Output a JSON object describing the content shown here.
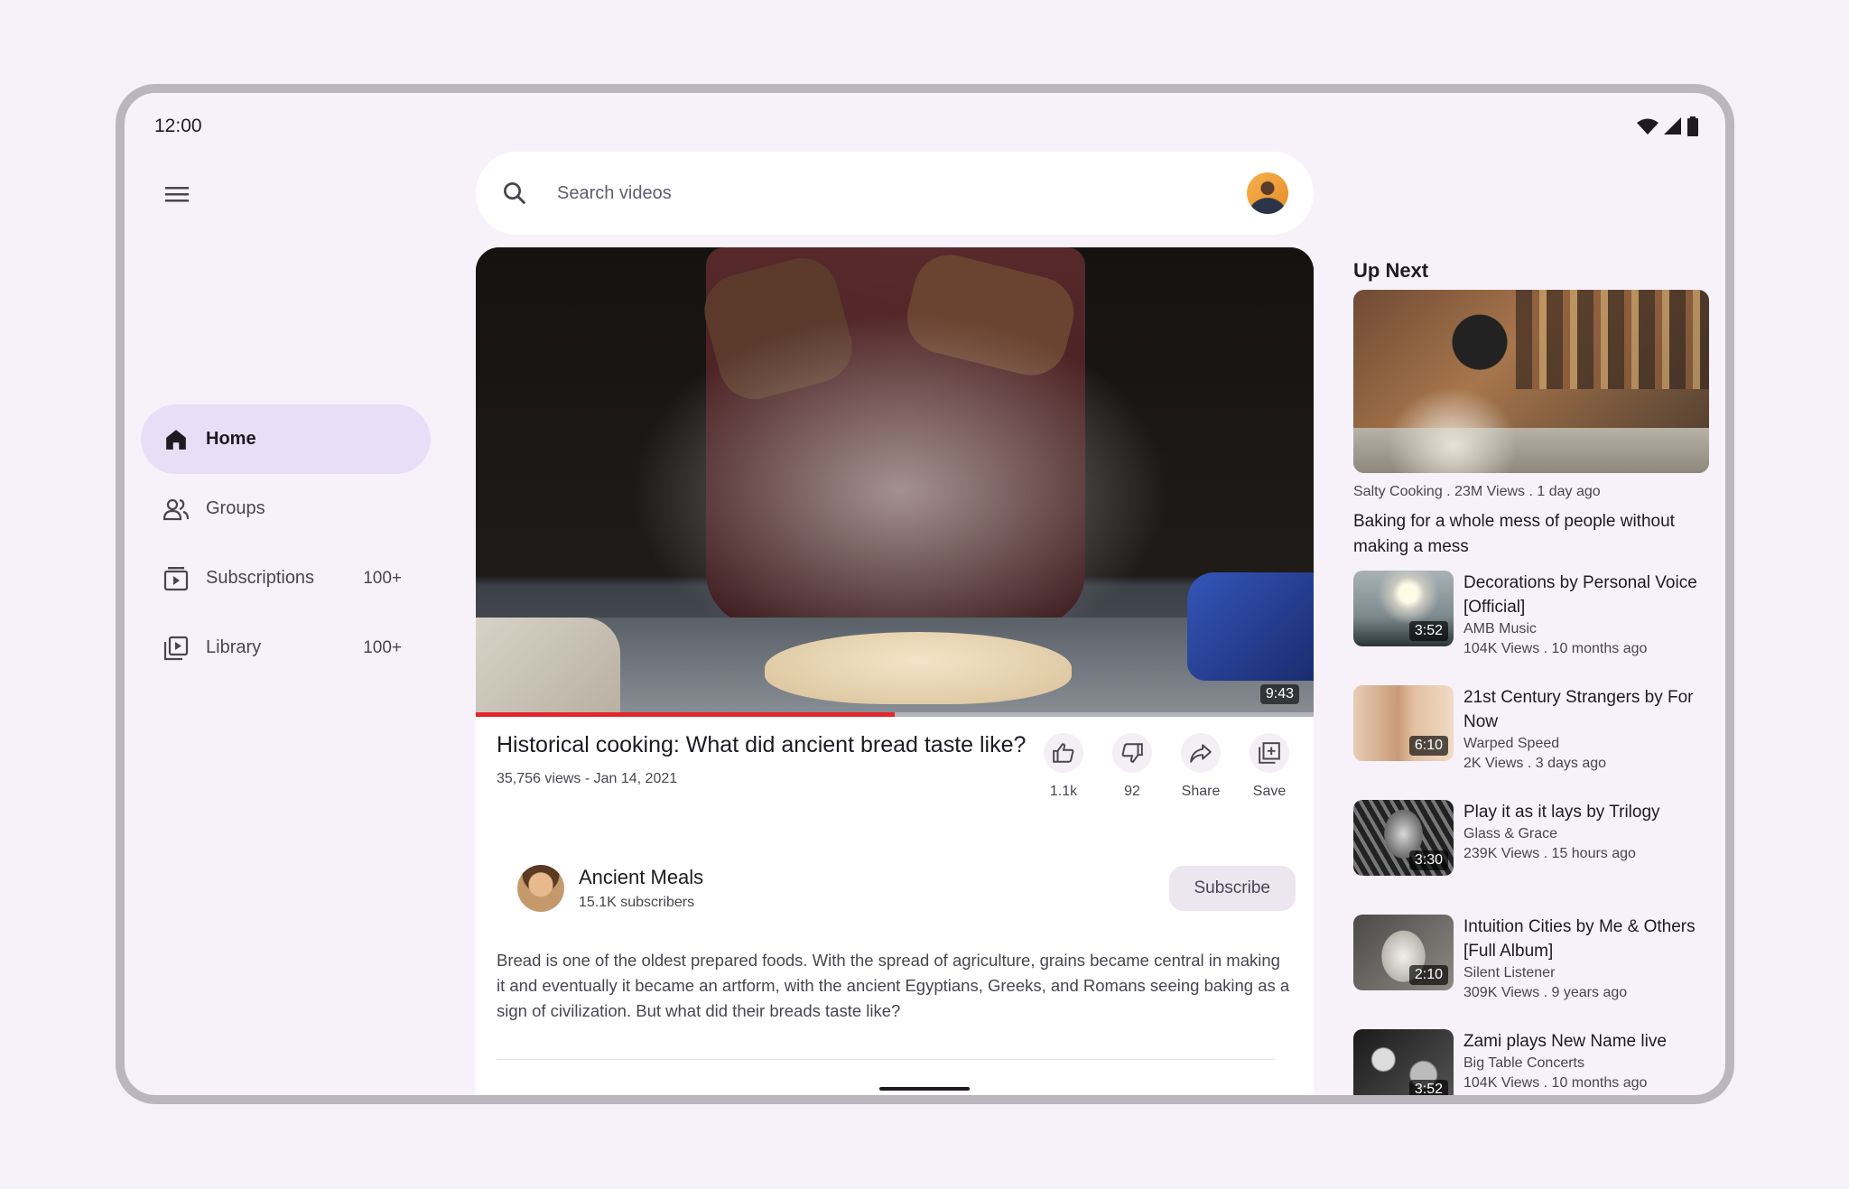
{
  "status_bar": {
    "time": "12:00",
    "icons": [
      "wifi-icon",
      "signal-icon",
      "battery-icon"
    ]
  },
  "nav": {
    "items": [
      {
        "label": "Home",
        "badge": "",
        "icon": "home-icon",
        "active": true
      },
      {
        "label": "Groups",
        "badge": "",
        "icon": "groups-icon",
        "active": false
      },
      {
        "label": "Subscriptions",
        "badge": "100+",
        "icon": "subscriptions-icon",
        "active": false
      },
      {
        "label": "Library",
        "badge": "100+",
        "icon": "library-icon",
        "active": false
      }
    ]
  },
  "search": {
    "placeholder": "Search videos",
    "value": ""
  },
  "video": {
    "duration": "9:43",
    "title": "Historical cooking: What did ancient bread taste like?",
    "meta": "35,756 views - Jan 14, 2021",
    "progress_fraction": 0.5,
    "actions": [
      {
        "label": "1.1k",
        "icon": "thumbs-up-icon"
      },
      {
        "label": "92",
        "icon": "thumbs-down-icon"
      },
      {
        "label": "Share",
        "icon": "share-icon"
      },
      {
        "label": "Save",
        "icon": "save-icon"
      }
    ],
    "channel": {
      "name": "Ancient Meals",
      "subscribers": "15.1K subscribers",
      "subscribe_label": "Subscribe"
    },
    "description": "Bread is one of the oldest prepared foods. With the spread of agriculture, grains became central in making it and eventually it became an artform, with the ancient Egyptians, Greeks, and Romans seeing baking as a sign of civilization. But what did their breads taste like?"
  },
  "upnext": {
    "heading": "Up Next",
    "featured": {
      "meta": "Salty Cooking . 23M Views . 1 day ago",
      "title": "Baking for a whole mess of people without making a mess"
    },
    "items": [
      {
        "title": "Decorations by Personal Voice [Official]",
        "channel": "AMB Music",
        "meta": "104K Views . 10 months ago",
        "duration": "3:52"
      },
      {
        "title": "21st Century Strangers by For Now",
        "channel": "Warped Speed",
        "meta": "2K Views . 3 days ago",
        "duration": "6:10"
      },
      {
        "title": "Play it as it lays by Trilogy",
        "channel": "Glass & Grace",
        "meta": "239K Views . 15 hours ago",
        "duration": "3:30"
      },
      {
        "title": "Intuition Cities by Me & Others [Full Album]",
        "channel": "Silent Listener",
        "meta": "309K Views . 9 years ago",
        "duration": "2:10"
      },
      {
        "title": "Zami plays New Name live",
        "channel": "Big Table Concerts",
        "meta": "104K Views . 10 months ago",
        "duration": "3:52"
      }
    ]
  }
}
